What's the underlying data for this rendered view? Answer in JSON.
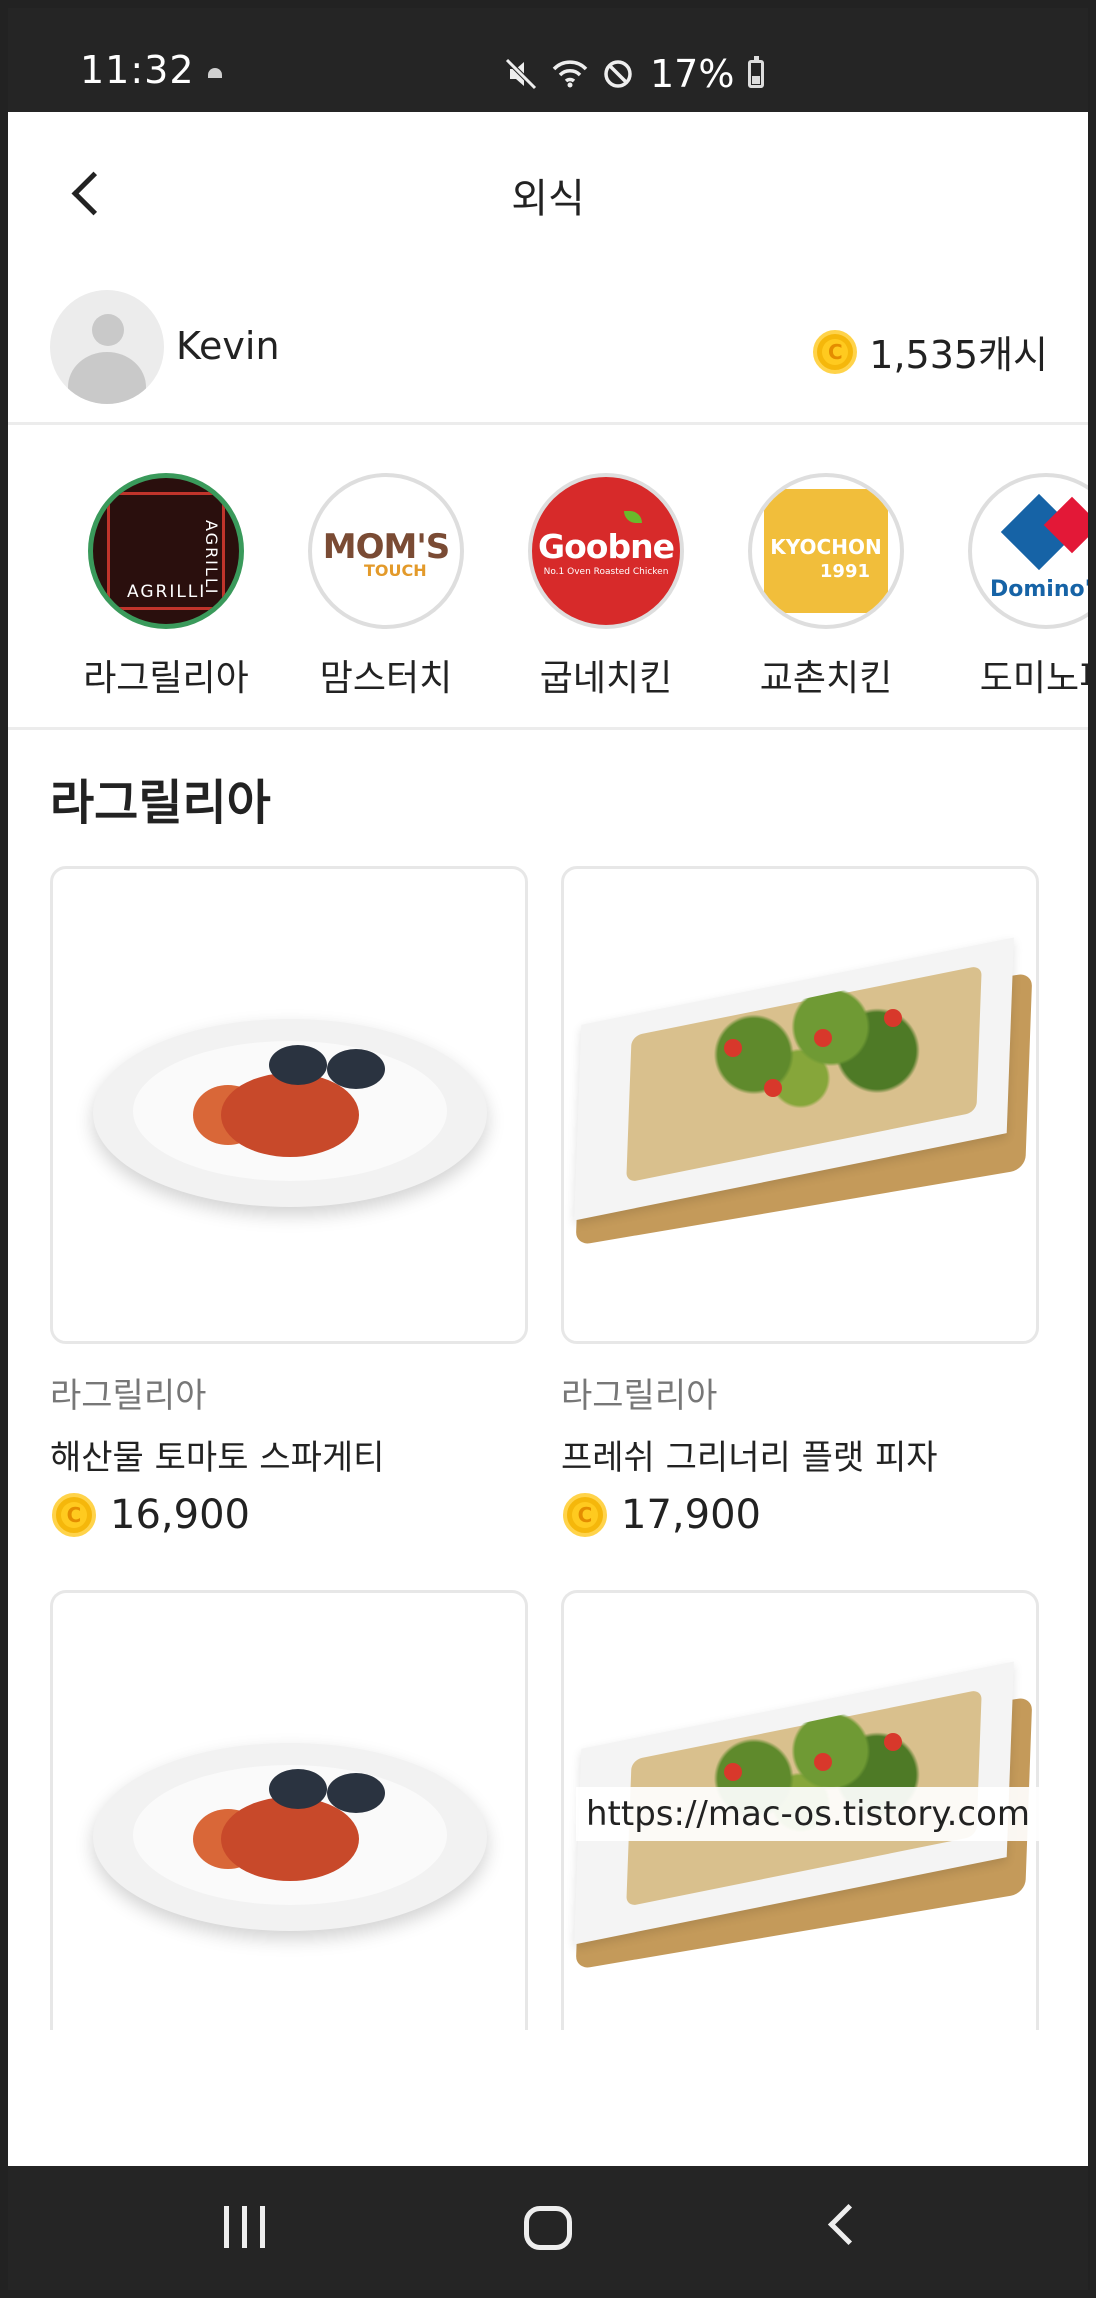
{
  "status_bar": {
    "time": "11:32",
    "battery": "17%"
  },
  "header": {
    "title": "외식"
  },
  "profile": {
    "name": "Kevin",
    "cash": "1,535캐시"
  },
  "brands": [
    {
      "label": "라그릴리아",
      "logo_text": "AGRILLI"
    },
    {
      "label": "맘스터치",
      "logo_text": "MOM'S",
      "logo_sub": "TOUCH"
    },
    {
      "label": "굽네치킨",
      "logo_text": "Goobne",
      "logo_sub": "No.1 Oven Roasted Chicken"
    },
    {
      "label": "교촌치킨",
      "logo_text": "KYOCHON",
      "logo_sub": "1991"
    },
    {
      "label": "도미노피",
      "logo_text": "Domino's"
    }
  ],
  "section": {
    "title": "라그릴리아"
  },
  "products": [
    {
      "brand": "라그릴리아",
      "name": "해산물 토마토 스파게티",
      "price": "16,900",
      "image": "seafood-pasta"
    },
    {
      "brand": "라그릴리아",
      "name": "프레쉬 그리너리 플랫 피자",
      "price": "17,900",
      "image": "flat-pizza"
    },
    {
      "image": "seafood-pasta"
    },
    {
      "image": "flat-pizza"
    }
  ],
  "coin_symbol": "C",
  "watermark": "https://mac-os.tistory.com",
  "colors": {
    "coin": "#f5b70b",
    "goobne": "#d72a2a",
    "kyochon": "#f1be3b",
    "dominos": "#1663a6"
  }
}
